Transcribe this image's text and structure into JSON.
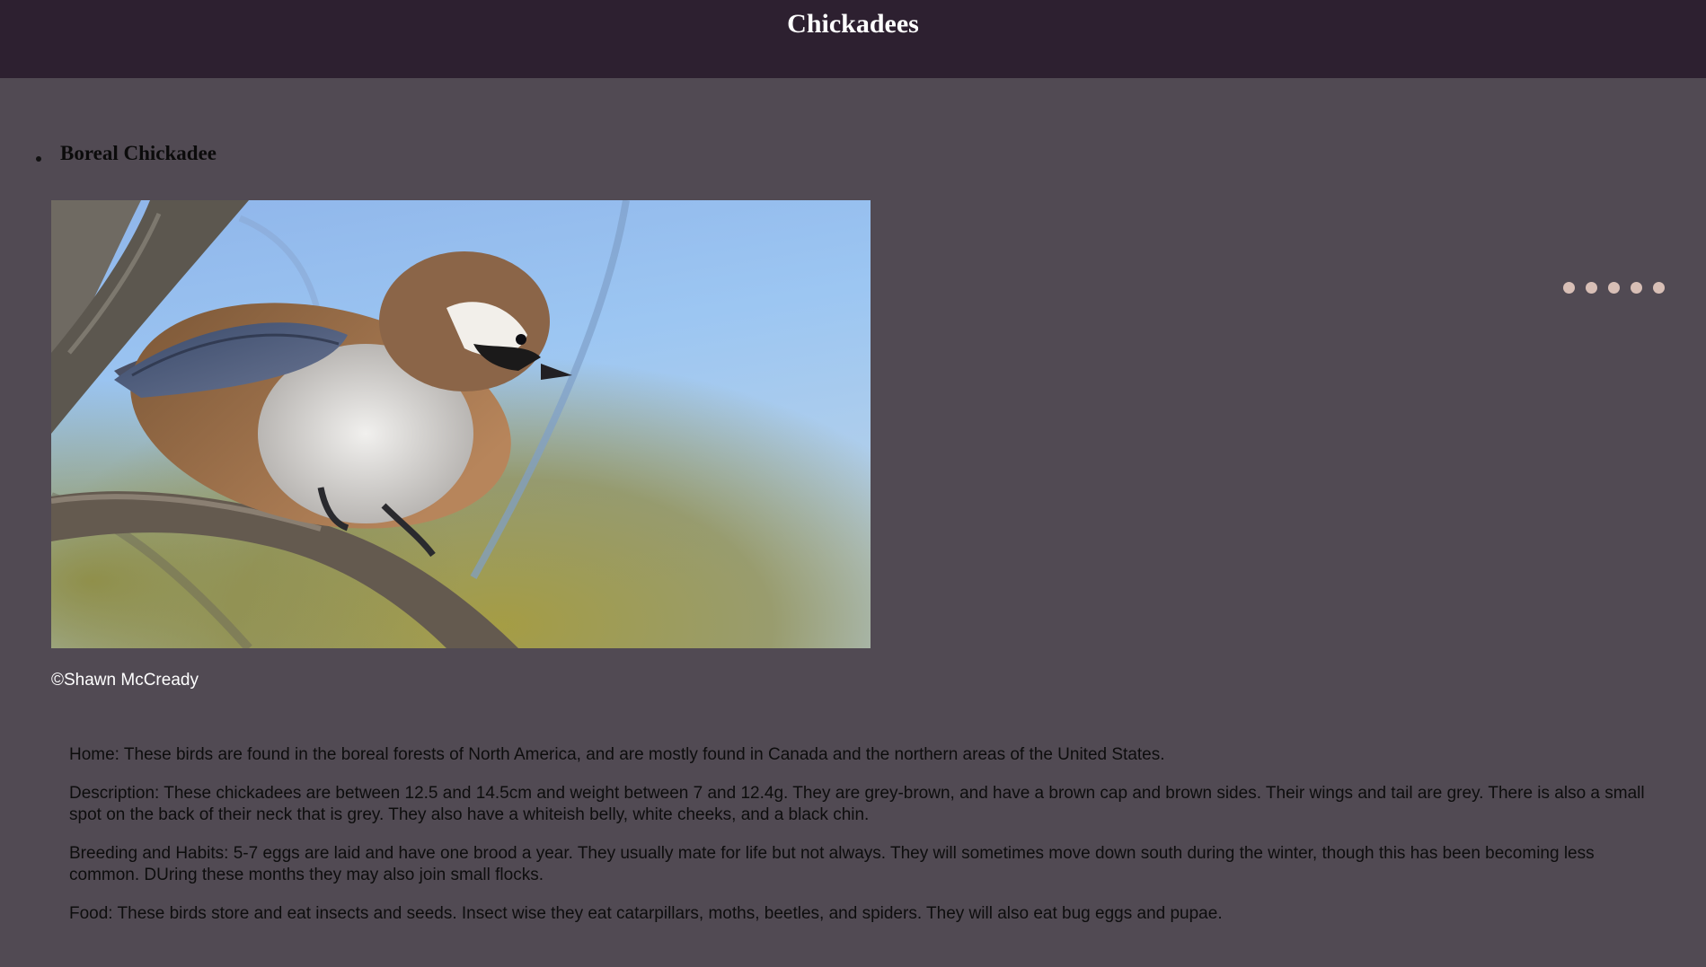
{
  "header": {
    "title": "Chickadees"
  },
  "birds": [
    {
      "name": "Boreal Chickadee",
      "photo_credit": "©Shawn McCready",
      "info": [
        "Home: These birds are found in the boreal forests of North America, and are mostly found in Canada and the northern areas of the United States.",
        "Description: These chickadees are between 12.5 and 14.5cm and weight between 7 and 12.4g. They are grey-brown, and have a brown cap and brown sides. Their wings and tail are grey. There is also a small spot on the back of their neck that is grey. They also have a whiteish belly, white cheeks, and a black chin.",
        "Breeding and Habits: 5-7 eggs are laid and have one brood a year. They usually mate for life but not always. They will sometimes move down south during the winter, though this has been becoming less common. DUring these months they may also join small flocks.",
        "Food: These birds store and eat insects and seeds. Insect wise they eat catarpillars, moths, beetles, and spiders. They will also eat bug eggs and pupae."
      ]
    }
  ],
  "carousel": {
    "slide_count": 5,
    "dot_color": "#d8bfb6"
  },
  "colors": {
    "header_bg": "#2d2030",
    "page_bg": "#514a53"
  }
}
